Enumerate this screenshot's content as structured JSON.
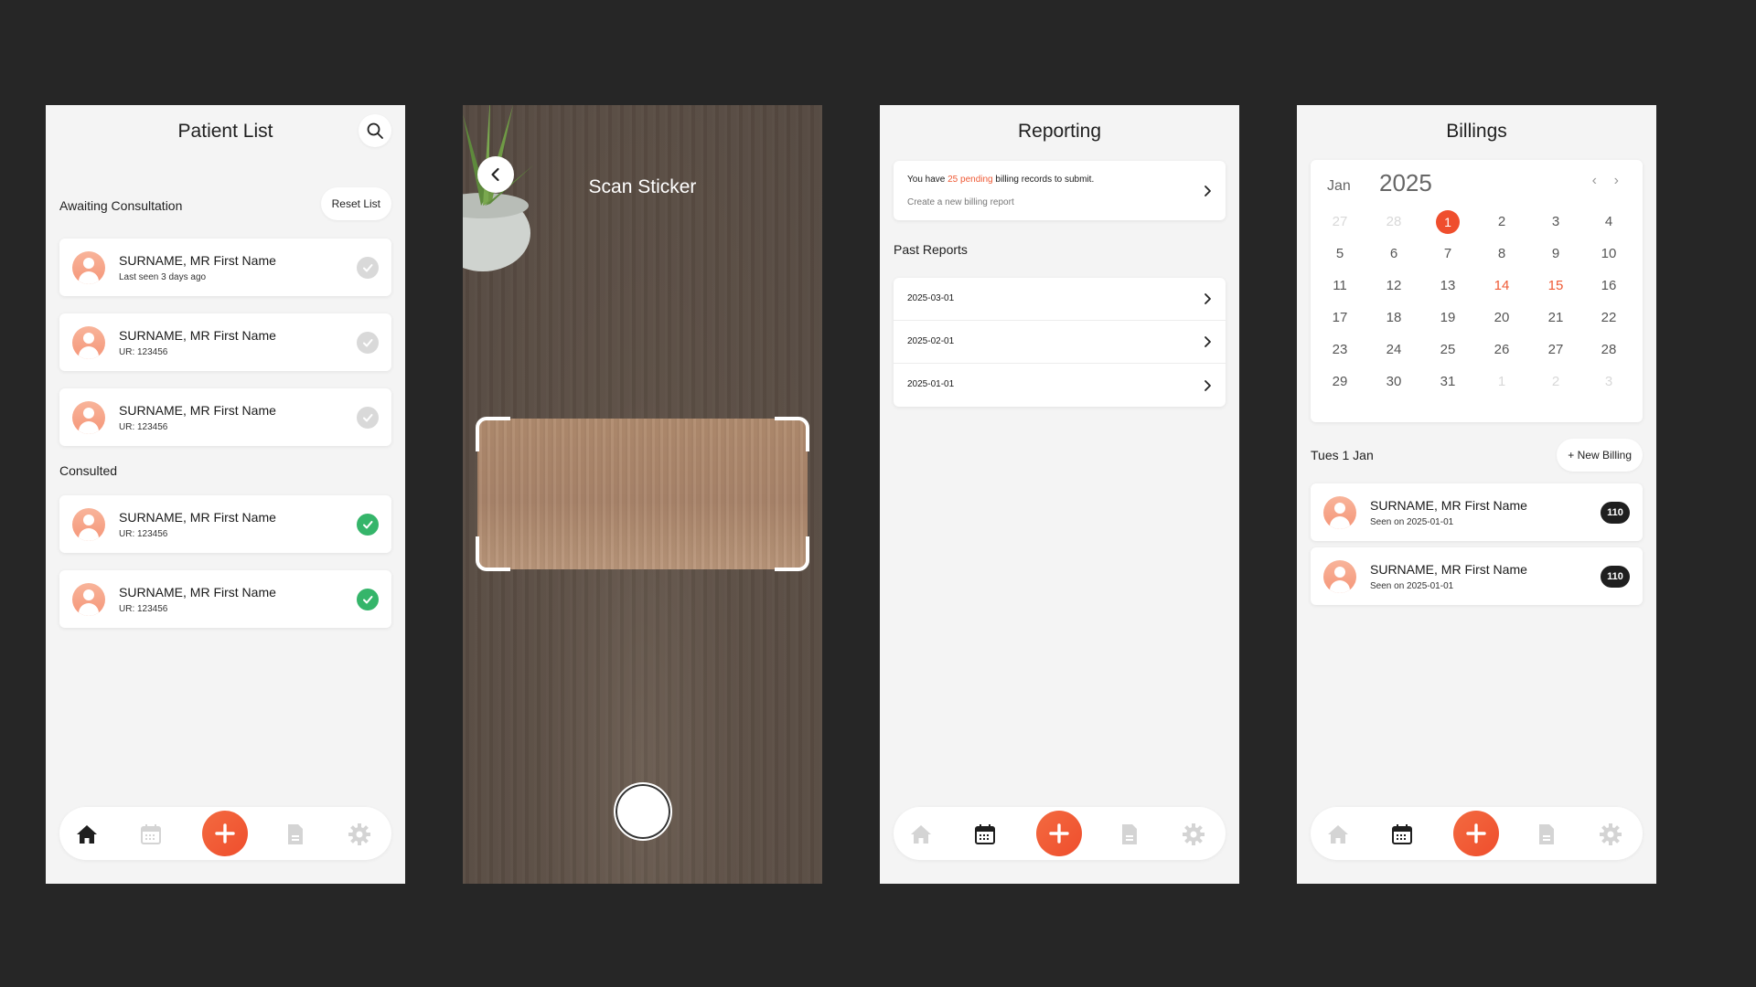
{
  "colors": {
    "accent": "#EF4E2D",
    "check_done": "#35B56A",
    "check_pending": "#D9D9D9",
    "background": "#262626",
    "screen": "#F4F4F4"
  },
  "patient_list": {
    "title": "Patient List",
    "awaiting_label": "Awaiting Consultation",
    "reset_label": "Reset List",
    "consulted_label": "Consulted",
    "awaiting": [
      {
        "name": "SURNAME, MR First Name",
        "sub": "Last seen 3 days ago",
        "status": "pending"
      },
      {
        "name": "SURNAME, MR First Name",
        "sub": "UR: 123456",
        "status": "pending"
      },
      {
        "name": "SURNAME, MR First Name",
        "sub": "UR: 123456",
        "status": "pending"
      }
    ],
    "consulted": [
      {
        "name": "SURNAME, MR First Name",
        "sub": "UR: 123456",
        "status": "done"
      },
      {
        "name": "SURNAME, MR First Name",
        "sub": "UR: 123456",
        "status": "done"
      }
    ]
  },
  "scan": {
    "title": "Scan Sticker"
  },
  "reporting": {
    "title": "Reporting",
    "notice_prefix": "You have ",
    "notice_highlight": "25 pending",
    "notice_suffix": " billing records to submit.",
    "notice_sub": "Create a new billing report",
    "past_label": "Past Reports",
    "reports": [
      "2025-03-01",
      "2025-02-01",
      "2025-01-01"
    ]
  },
  "billings": {
    "title": "Billings",
    "month": "Jan",
    "year": "2025",
    "prev_icon": "‹",
    "next_icon": "›",
    "weeks": [
      [
        "27",
        "28",
        "1",
        "2",
        "3",
        "4"
      ],
      [
        "5",
        "6",
        "7",
        "8",
        "9",
        "10"
      ],
      [
        "11",
        "12",
        "13",
        "14",
        "15",
        "16"
      ],
      [
        "17",
        "18",
        "19",
        "20",
        "21",
        "22"
      ],
      [
        "23",
        "24",
        "25",
        "26",
        "27",
        "28"
      ],
      [
        "29",
        "30",
        "31",
        "1",
        "2",
        "3"
      ]
    ],
    "selected_day": "1",
    "date_label": "Tues 1 Jan",
    "new_billing_label": "+ New Billing",
    "entries": [
      {
        "name": "SURNAME, MR First Name",
        "sub": "Seen on 2025-01-01",
        "badge": "110"
      },
      {
        "name": "SURNAME, MR First Name",
        "sub": "Seen on 2025-01-01",
        "badge": "110"
      }
    ]
  },
  "nav_icons": [
    "home-icon",
    "calendar-icon",
    "plus-icon",
    "document-icon",
    "settings-icon"
  ]
}
